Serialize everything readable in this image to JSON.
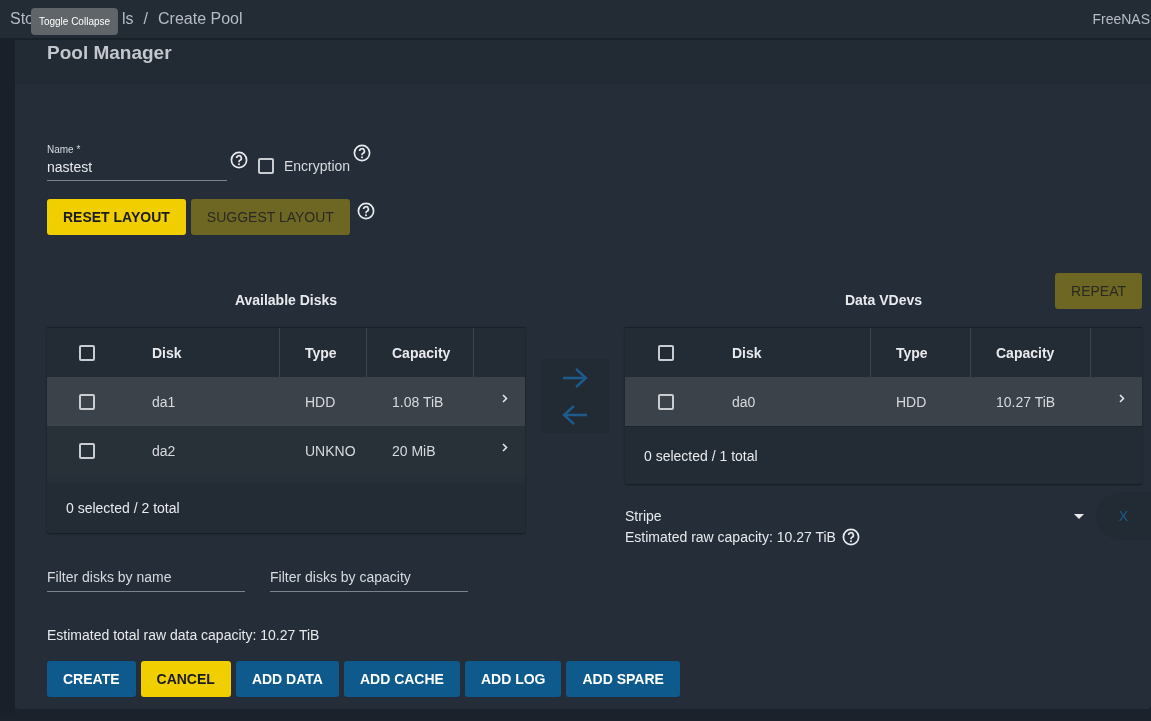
{
  "breadcrumb": {
    "start": "Sto",
    "end": "ls",
    "separator": "/",
    "current": "Create Pool"
  },
  "tooltip": {
    "text": "Toggle Collapse"
  },
  "brand": "FreeNAS",
  "card": {
    "title": "Pool Manager"
  },
  "name_field": {
    "label": "Name",
    "required_mark": "*",
    "value": "nastest"
  },
  "encryption": {
    "label": "Encryption",
    "checked": false
  },
  "layout_buttons": [
    {
      "label": "RESET LAYOUT",
      "kind": "accent",
      "disabled": false
    },
    {
      "label": "SUGGEST LAYOUT",
      "kind": "accent",
      "disabled": true
    }
  ],
  "available": {
    "title": "Available Disks",
    "columns": [
      "Disk",
      "Type",
      "Capacity"
    ],
    "all_checked": false,
    "rows": [
      {
        "disk": "da1",
        "type": "HDD",
        "capacity": "1.08 TiB",
        "checked": false,
        "highlighted": true
      },
      {
        "disk": "da2",
        "type": "UNKNO",
        "capacity": "20 MiB",
        "checked": false,
        "highlighted": false
      }
    ],
    "footer": "0 selected / 2 total"
  },
  "filters": [
    {
      "placeholder": "Filter disks by name"
    },
    {
      "placeholder": "Filter disks by capacity"
    }
  ],
  "total": "Estimated total raw data capacity: 10.27 TiB",
  "vdevs": {
    "title": "Data VDevs",
    "repeat": {
      "label": "REPEAT",
      "disabled": true
    },
    "columns": [
      "Disk",
      "Type",
      "Capacity"
    ],
    "all_checked": false,
    "rows": [
      {
        "disk": "da0",
        "type": "HDD",
        "capacity": "10.27 TiB",
        "checked": false,
        "highlighted": true
      }
    ],
    "footer": "0 selected / 1 total",
    "layout": "Stripe",
    "capacity": "Estimated raw capacity: 10.27 TiB",
    "remove": "X"
  },
  "actions": [
    {
      "label": "CREATE",
      "kind": "primary"
    },
    {
      "label": "CANCEL",
      "kind": "accent"
    },
    {
      "label": "ADD DATA",
      "kind": "primary"
    },
    {
      "label": "ADD CACHE",
      "kind": "primary"
    },
    {
      "label": "ADD LOG",
      "kind": "primary"
    },
    {
      "label": "ADD SPARE",
      "kind": "primary"
    }
  ]
}
